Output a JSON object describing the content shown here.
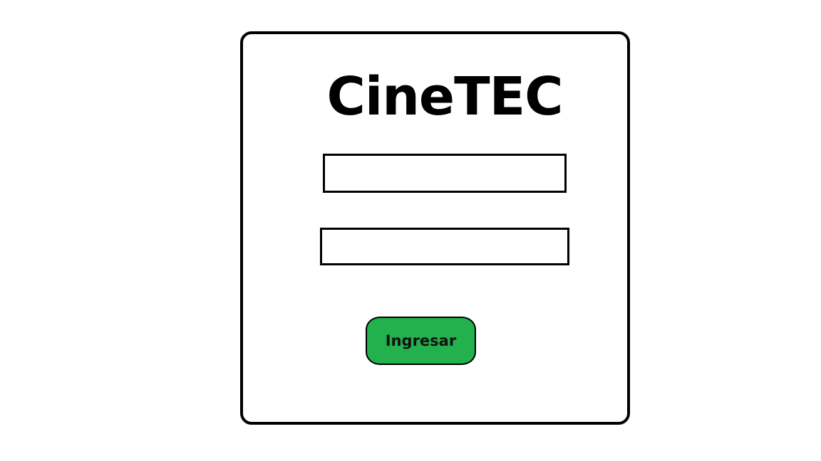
{
  "login": {
    "title": "CineTEC",
    "username": {
      "value": "",
      "placeholder": ""
    },
    "password": {
      "value": "",
      "placeholder": ""
    },
    "submit_label": "Ingresar"
  },
  "colors": {
    "background": "#ffffff",
    "border": "#000000",
    "button": "#22b14c"
  }
}
